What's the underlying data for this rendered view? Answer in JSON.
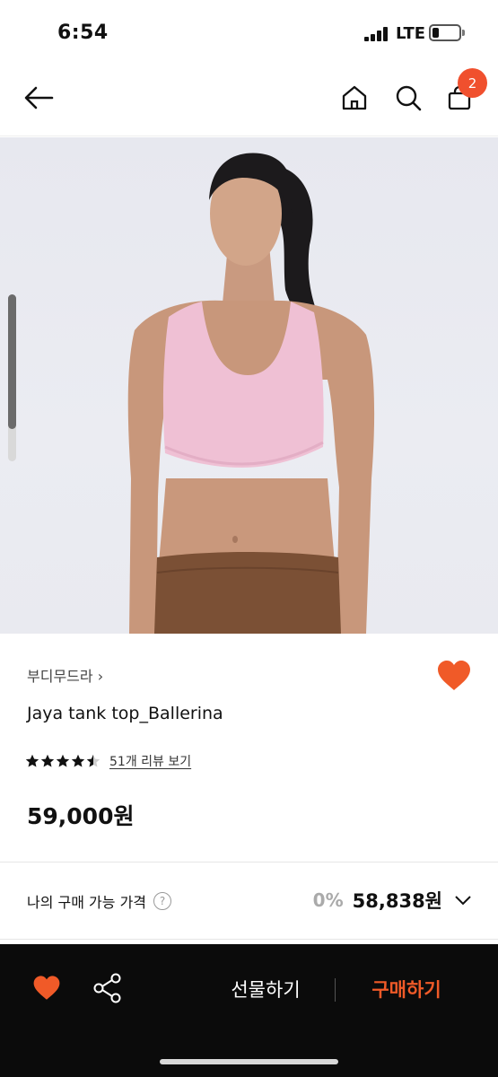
{
  "status_bar": {
    "time": "6:54",
    "network": "LTE",
    "battery_level": 0.25
  },
  "header": {
    "icons": [
      "back-arrow-icon",
      "home-icon",
      "search-icon",
      "shopping-bag-icon"
    ],
    "cart_count": "2"
  },
  "gallery": {
    "scroll_position": 0.2
  },
  "product": {
    "brand": "부디무드라",
    "brand_chevron": "›",
    "name": "Jaya tank top_Ballerina",
    "rating": 4.5,
    "review_link": "51개 리뷰 보기",
    "price": "59,000원",
    "liked": true
  },
  "my_price": {
    "label": "나의 구매 가능 가격",
    "help": "?",
    "discount": "0%",
    "price": "58,838원"
  },
  "bottom_bar": {
    "gift_label": "선물하기",
    "buy_label": "구매하기",
    "icons": [
      "heart-icon",
      "share-icon"
    ]
  },
  "colors": {
    "accent": "#f05a28",
    "badge": "#f0502e",
    "bar_bg": "#0b0b0b"
  }
}
